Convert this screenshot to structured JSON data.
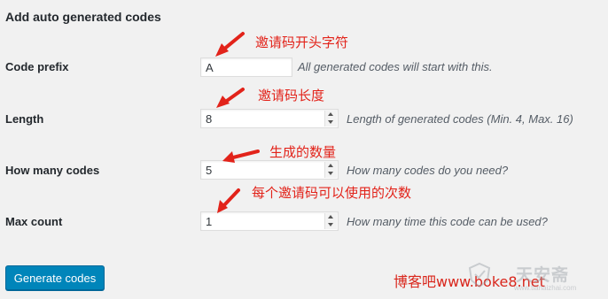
{
  "form": {
    "title": "Add auto generated codes",
    "fields": [
      {
        "label": "Code prefix",
        "value": "A",
        "help": "All generated codes will start with this.",
        "annotation": "邀请码开头字符"
      },
      {
        "label": "Length",
        "value": "8",
        "help": "Length of generated codes (Min. 4, Max. 16)",
        "annotation": "邀请码长度"
      },
      {
        "label": "How many codes",
        "value": "5",
        "help": "How many codes do you need?",
        "annotation": "生成的数量"
      },
      {
        "label": "Max count",
        "value": "1",
        "help": "How many time this code can be used?",
        "annotation": "每个邀请码可以使用的次数"
      }
    ],
    "submit_label": "Generate codes"
  },
  "footer": {
    "credit": "博客吧www.boke8.net"
  },
  "watermark": {
    "name": "天安斋",
    "url": "www.tianaizhai.com"
  },
  "colors": {
    "background": "#f1f1f1",
    "primary_button": "#0085ba",
    "annotation_red": "#e2231a"
  },
  "icons": {
    "spinner": "up-down-arrows",
    "annotation_arrow": "red-arrow"
  }
}
